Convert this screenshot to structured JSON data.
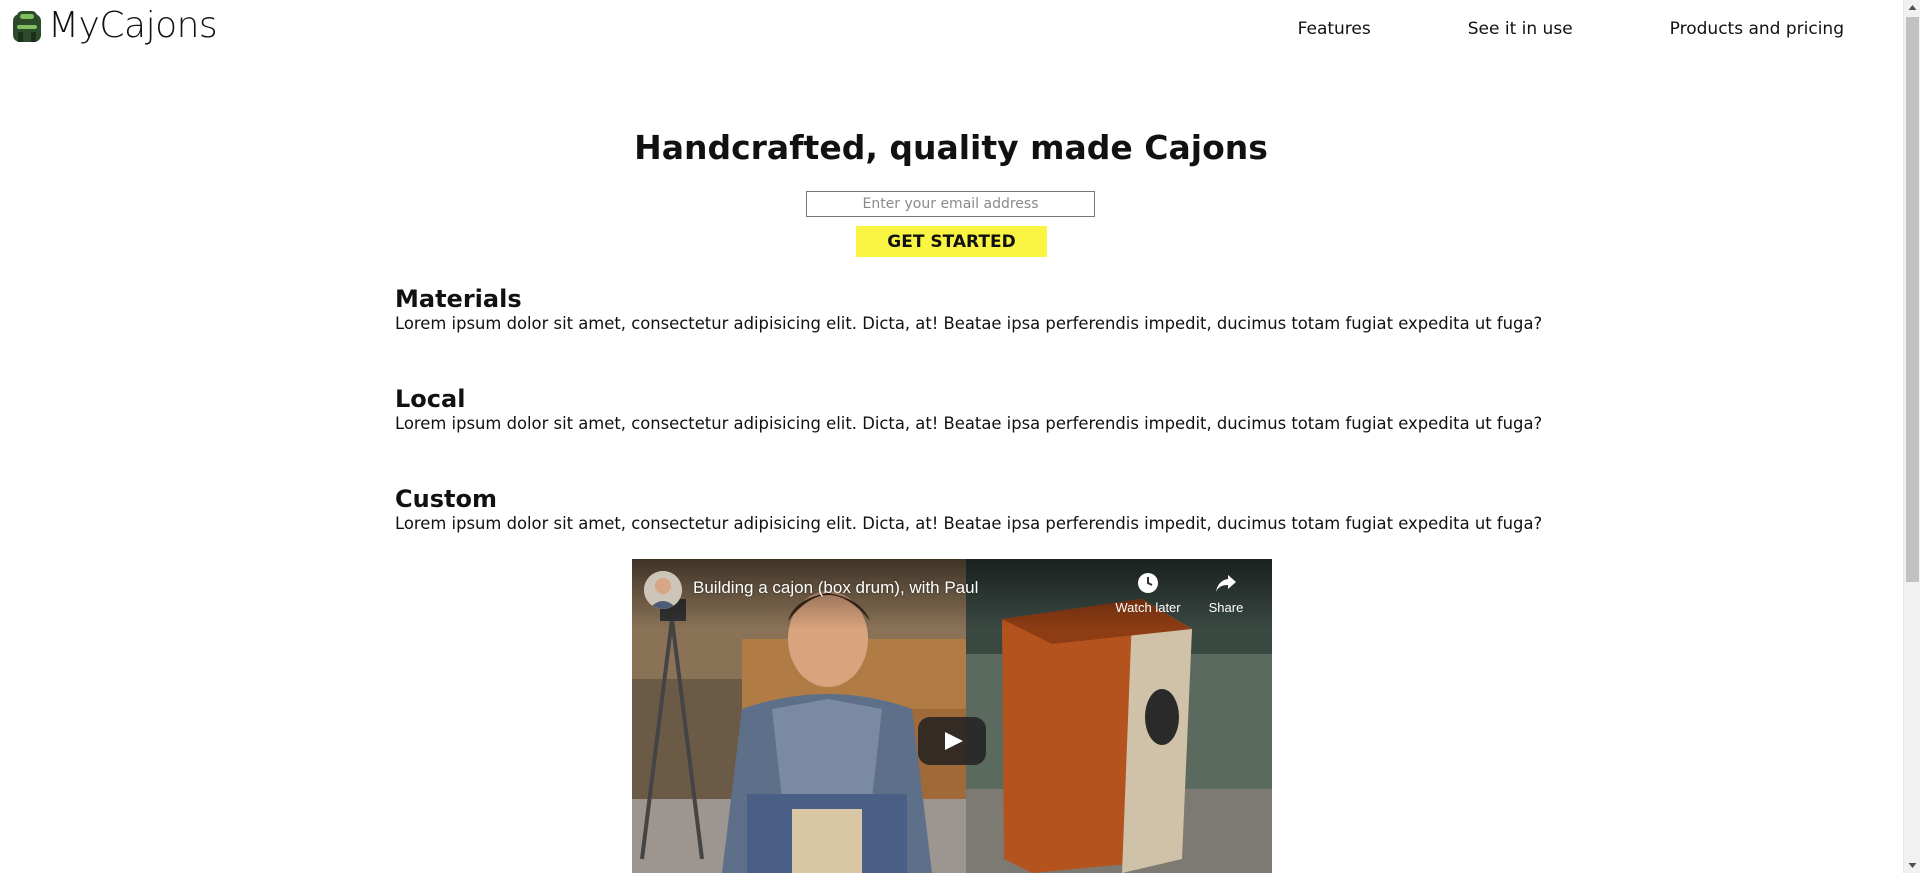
{
  "header": {
    "brand_name": "MyCajons",
    "logo_icon": "cajon-logo-icon",
    "nav": {
      "features": "Features",
      "see_it_in_use": "See it in use",
      "products_and_pricing": "Products and pricing"
    }
  },
  "hero": {
    "title": "Handcrafted, quality made Cajons",
    "email_placeholder": "Enter your email address",
    "cta_label": "GET STARTED",
    "cta_color": "#faf542"
  },
  "features": [
    {
      "title": "Materials",
      "text": "Lorem ipsum dolor sit amet, consectetur adipisicing elit. Dicta, at! Beatae ipsa perferendis impedit, ducimus totam fugiat expedita ut fuga?"
    },
    {
      "title": "Local",
      "text": "Lorem ipsum dolor sit amet, consectetur adipisicing elit. Dicta, at! Beatae ipsa perferendis impedit, ducimus totam fugiat expedita ut fuga?"
    },
    {
      "title": "Custom",
      "text": "Lorem ipsum dolor sit amet, consectetur adipisicing elit. Dicta, at! Beatae ipsa perferendis impedit, ducimus totam fugiat expedita ut fuga?"
    }
  ],
  "video": {
    "title": "Building a cajon (box drum), with Paul",
    "watch_later_label": "Watch later",
    "share_label": "Share",
    "icons": {
      "watch_later": "clock-icon",
      "share": "share-icon",
      "play": "play-icon"
    }
  }
}
